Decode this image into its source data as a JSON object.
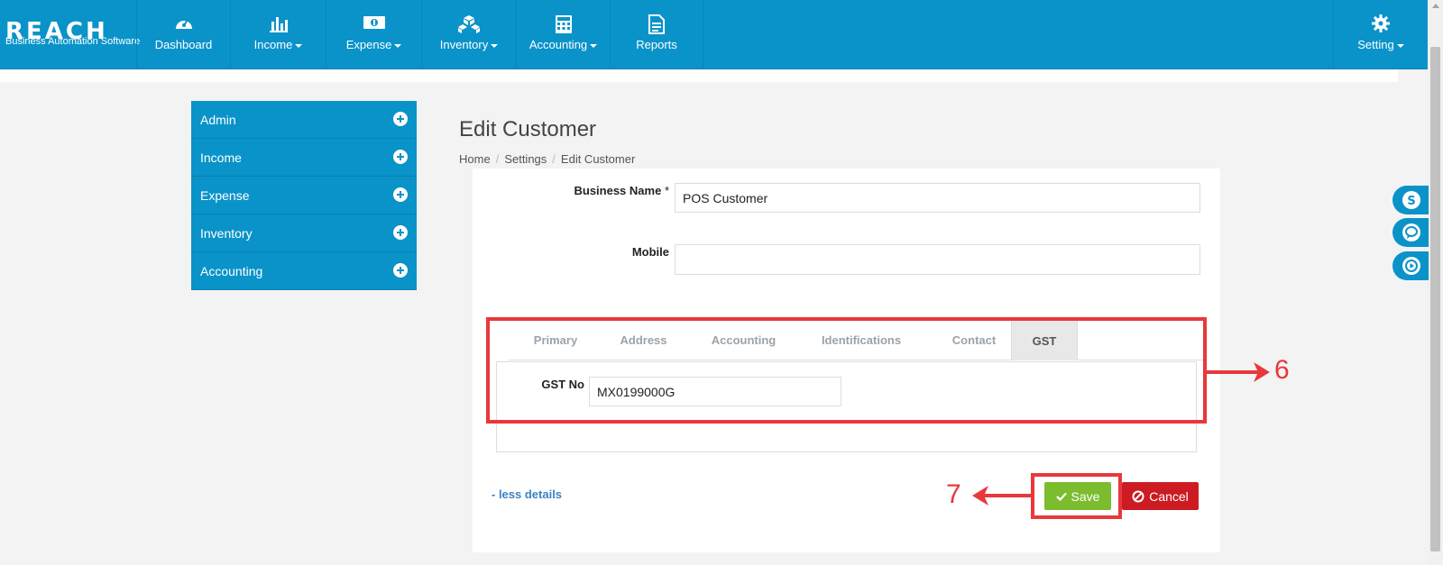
{
  "logo": {
    "word": "REACH",
    "tagline": "Business Automation Software"
  },
  "nav": {
    "items": [
      {
        "label": "Dashboard",
        "icon": "dashboard-icon",
        "dropdown": false
      },
      {
        "label": "Income",
        "icon": "bar-chart-icon",
        "dropdown": true
      },
      {
        "label": "Expense",
        "icon": "money-icon",
        "dropdown": true
      },
      {
        "label": "Inventory",
        "icon": "cubes-icon",
        "dropdown": true
      },
      {
        "label": "Accounting",
        "icon": "calculator-icon",
        "dropdown": true
      },
      {
        "label": "Reports",
        "icon": "document-icon",
        "dropdown": false
      }
    ],
    "setting": {
      "label": "Setting",
      "icon": "gear-icon"
    }
  },
  "sidebar": {
    "items": [
      {
        "label": "Admin"
      },
      {
        "label": "Income"
      },
      {
        "label": "Expense"
      },
      {
        "label": "Inventory"
      },
      {
        "label": "Accounting"
      }
    ]
  },
  "page": {
    "title": "Edit Customer",
    "breadcrumb": [
      "Home",
      "Settings",
      "Edit Customer"
    ]
  },
  "form": {
    "business_name_label": "Business Name",
    "required_mark": "*",
    "business_name_value": "POS Customer",
    "mobile_label": "Mobile",
    "mobile_value": "",
    "gst_label": "GST No",
    "gst_value": "MX0199000G"
  },
  "tabs": {
    "items": [
      "Primary",
      "Address",
      "Accounting",
      "Identifications",
      "Contact",
      "GST"
    ],
    "active": "GST"
  },
  "actions": {
    "less_details": "- less details",
    "save": "Save",
    "cancel": "Cancel"
  },
  "annotations": {
    "step6": "6",
    "step7": "7"
  },
  "colors": {
    "primary": "#0a93c9",
    "save": "#7cbd2f",
    "cancel": "#cc1b22",
    "annotation": "#e8383b"
  }
}
